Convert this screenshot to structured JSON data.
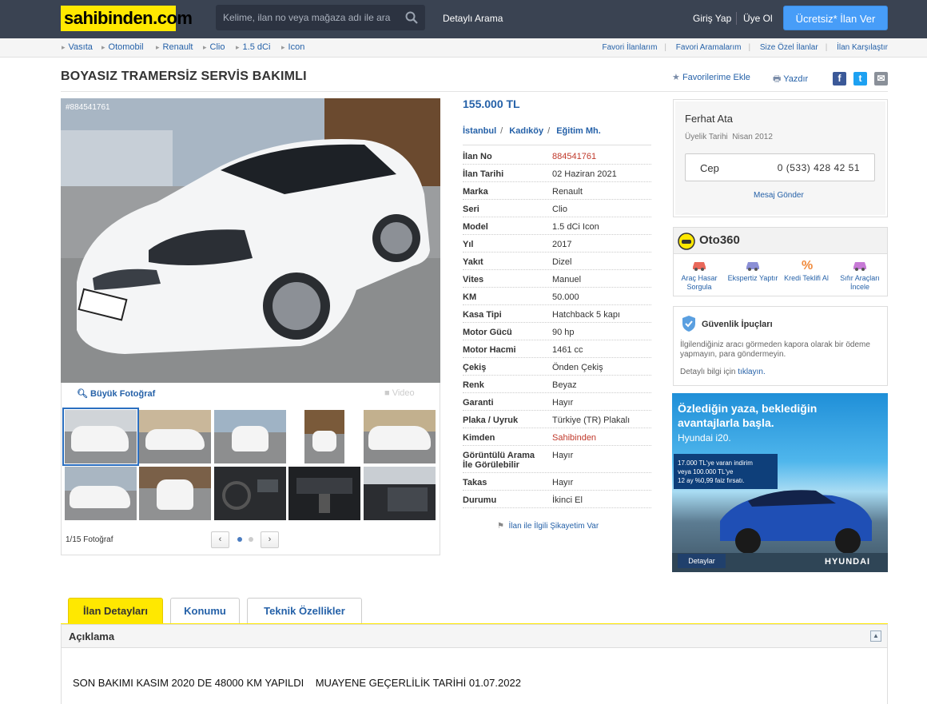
{
  "header": {
    "logo": "sahibinden.com",
    "search_placeholder": "Kelime, ilan no veya mağaza adı ile ara",
    "advanced_search": "Detaylı Arama",
    "login": "Giriş Yap",
    "signup": "Üye Ol",
    "post_button": "Ücretsiz* İlan Ver"
  },
  "breadcrumb": [
    "Vasıta",
    "Otomobil",
    "Renault",
    "Clio",
    "1.5 dCi",
    "Icon"
  ],
  "quicklinks": [
    "Favori İlanlarım",
    "Favori Aramalarım",
    "Size Özel İlanlar",
    "İlan Karşılaştır"
  ],
  "listing": {
    "title": "BOYASIZ TRAMERSİZ SERVİS BAKIMLI",
    "add_favorite": "Favorilerime Ekle",
    "print": "Yazdır",
    "photo_watermark": "#884541761",
    "big_photo": "Büyük Fotoğraf",
    "video": "Video",
    "photo_counter": "1/15 Fotoğraf",
    "price": "155.000 TL",
    "location": [
      "İstanbul",
      "Kadıköy",
      "Eğitim Mh."
    ],
    "complaint": "İlan ile İlgili Şikayetim Var"
  },
  "details": [
    {
      "k": "İlan No",
      "v": "884541761",
      "color": "#c0392b"
    },
    {
      "k": "İlan Tarihi",
      "v": "02 Haziran 2021"
    },
    {
      "k": "Marka",
      "v": "Renault"
    },
    {
      "k": "Seri",
      "v": "Clio"
    },
    {
      "k": "Model",
      "v": "1.5 dCi Icon"
    },
    {
      "k": "Yıl",
      "v": "2017"
    },
    {
      "k": "Yakıt",
      "v": "Dizel"
    },
    {
      "k": "Vites",
      "v": "Manuel"
    },
    {
      "k": "KM",
      "v": "50.000"
    },
    {
      "k": "Kasa Tipi",
      "v": "Hatchback 5 kapı"
    },
    {
      "k": "Motor Gücü",
      "v": "90 hp"
    },
    {
      "k": "Motor Hacmi",
      "v": "1461 cc"
    },
    {
      "k": "Çekiş",
      "v": "Önden Çekiş"
    },
    {
      "k": "Renk",
      "v": "Beyaz"
    },
    {
      "k": "Garanti",
      "v": "Hayır"
    },
    {
      "k": "Plaka / Uyruk",
      "v": "Türkiye (TR) Plakalı"
    },
    {
      "k": "Kimden",
      "v": "Sahibinden",
      "color": "#c0392b"
    },
    {
      "k": "Görüntülü Arama İle Görülebilir",
      "v": "Hayır"
    },
    {
      "k": "Takas",
      "v": "Hayır"
    },
    {
      "k": "Durumu",
      "v": "İkinci El"
    }
  ],
  "seller": {
    "name": "Ferhat Ata",
    "member_label": "Üyelik Tarihi",
    "member_date": "Nisan 2012",
    "phone_label": "Cep",
    "phone": "0 (533) 428 42 51",
    "message": "Mesaj Gönder"
  },
  "oto360": {
    "brand": "Oto360",
    "items": [
      "Araç Hasar Sorgula",
      "Ekspertiz Yaptır",
      "Kredi Teklifi Al",
      "Sıfır Araçları İncele"
    ]
  },
  "safety": {
    "title": "Güvenlik İpuçları",
    "text": "İlgilendiğiniz aracı görmeden kapora olarak bir ödeme yapmayın, para göndermeyin.",
    "more_prefix": "Detaylı bilgi için",
    "more_link": "tıklayın."
  },
  "ad": {
    "headline": "Özlediğin yaza, beklediğin avantajlarla başla.",
    "model": "Hyundai i20.",
    "offer_lines": [
      "17.000 TL'ye varan indirim",
      "veya 100.000 TL'ye",
      "12 ay %0,99 faiz fırsatı."
    ],
    "button": "Detaylar",
    "brand": "HYUNDAI"
  },
  "tabs": [
    "İlan Detayları",
    "Konumu",
    "Teknik Özellikler"
  ],
  "description": {
    "heading": "Açıklama",
    "lines": [
      "SON BAKIMI KASIM 2020 DE 48000 KM YAPILDI    MUAYENE GEÇERLİLİK TARİHİ 01.07.2022"
    ]
  },
  "colors": {
    "header_bg": "#3a4352",
    "logo_yellow": "#ffe800",
    "link_blue": "#2561a8",
    "post_button_blue": "#479df8",
    "accent_red": "#c0392b"
  }
}
